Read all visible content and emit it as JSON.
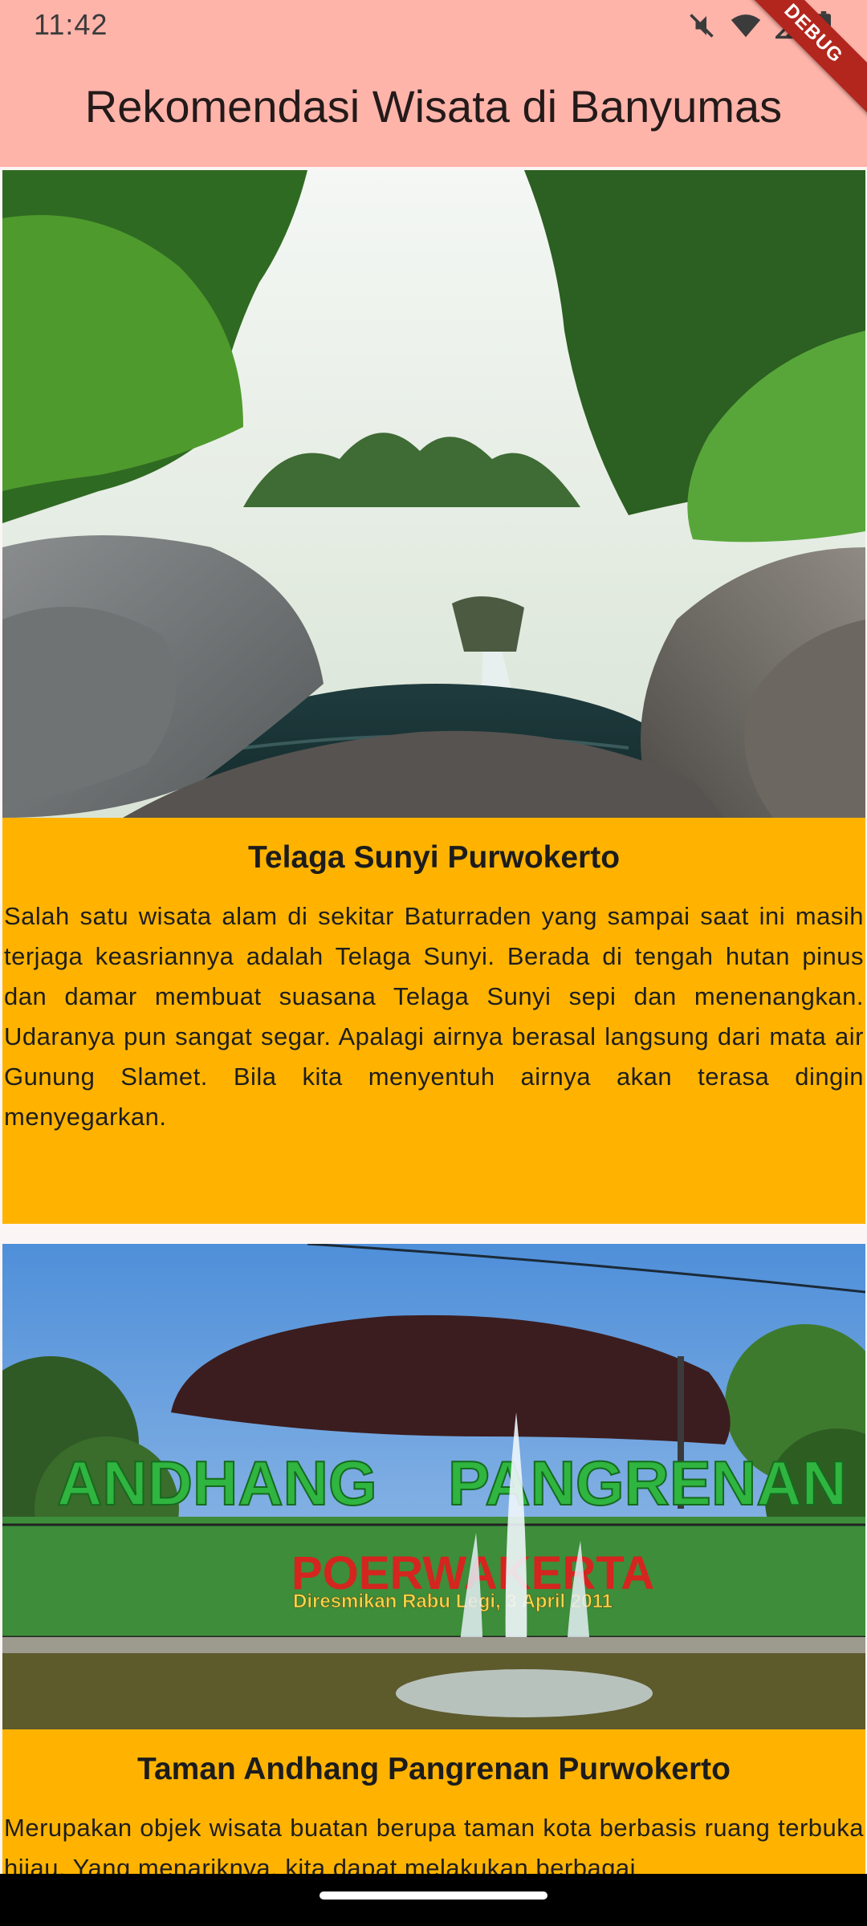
{
  "status_bar": {
    "time": "11:42",
    "icons": [
      "mute-icon",
      "wifi-icon",
      "signal-icon",
      "battery-icon"
    ]
  },
  "debug_banner": "DEBUG",
  "app_bar": {
    "title": "Rekomendasi Wisata di Banyumas",
    "background": "#ffb4aa"
  },
  "cards": [
    {
      "image": "waterfall-lake-photo",
      "title": "Telaga Sunyi Purwokerto",
      "description": "Salah satu wisata alam di sekitar Baturraden yang sampai saat ini masih terjaga keasriannya adalah Telaga Sunyi. Berada di tengah hutan pinus dan damar membuat suasana Telaga Sunyi sepi dan menenangkan. Udaranya pun sangat segar. Apalagi airnya berasal langsung dari mata air Gunung Slamet. Bila kita menyentuh airnya akan terasa dingin menyegarkan."
    },
    {
      "image": "park-sign-fountain-photo",
      "title": "Taman Andhang Pangrenan Purwokerto",
      "description": "Merupakan objek wisata buatan berupa taman kota berbasis ruang terbuka hijau. Yang menariknya, kita dapat melakukan berbagai",
      "image_sign": {
        "word1": "ANDHANG",
        "word2": "PANGRENAN",
        "subtitle": "POERWAKERTA",
        "plaque": "Diresmikan Rabu Legi, 3 April 2011"
      }
    }
  ],
  "colors": {
    "card_body": "#ffb300",
    "page_background": "#fbf5f5",
    "debug": "#b3261e"
  }
}
